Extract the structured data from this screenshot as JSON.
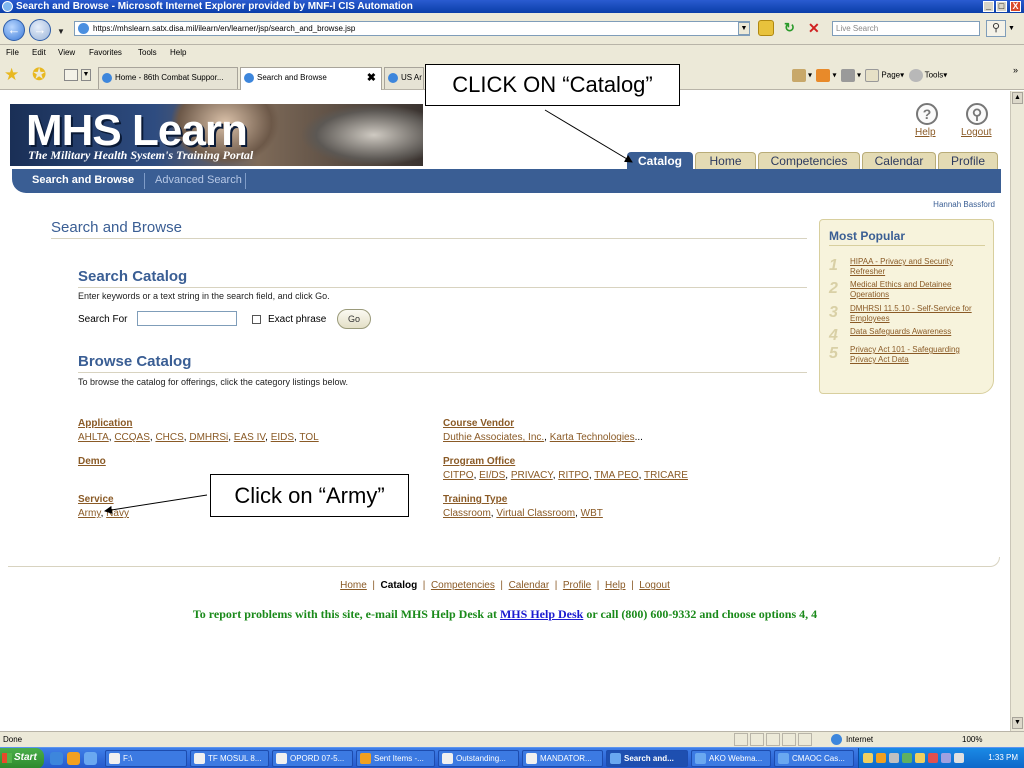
{
  "window": {
    "title": "Search and Browse - Microsoft Internet Explorer provided by MNF-I CIS Automation",
    "minimize": "_",
    "maximize": "□",
    "close": "X"
  },
  "address": {
    "url": "https://mhslearn.satx.disa.mil/ilearn/en/learner/jsp/search_and_browse.jsp",
    "search_placeholder": "Live Search"
  },
  "menu": [
    "File",
    "Edit",
    "View",
    "Favorites",
    "Tools",
    "Help"
  ],
  "tabs": [
    {
      "label": "Home - 86th Combat Suppor..."
    },
    {
      "label": "Search and Browse",
      "close": "✖"
    },
    {
      "label": "US Ar"
    }
  ],
  "command_bar": {
    "page": "Page",
    "tools": "Tools"
  },
  "site": {
    "logo": "MHS Learn",
    "tagline": "The Military Health System's Training Portal",
    "help": "Help",
    "logout": "Logout",
    "nav_tabs": [
      "Catalog",
      "Home",
      "Competencies",
      "Calendar",
      "Profile"
    ],
    "subnav": [
      "Search and Browse",
      "Advanced Search"
    ],
    "user_name": "Hannah Bassford"
  },
  "page": {
    "title": "Search and Browse",
    "search_catalog": {
      "heading": "Search Catalog",
      "instructions": "Enter keywords or a text string in the search field, and click Go.",
      "search_label": "Search For",
      "search_value": "",
      "exact_phrase": "Exact phrase",
      "go": "Go"
    },
    "browse_catalog": {
      "heading": "Browse Catalog",
      "instructions": "To browse the catalog for offerings, click the category listings below."
    },
    "categories": {
      "application": {
        "heading": "Application",
        "items": [
          "AHLTA",
          "CCQAS",
          "CHCS",
          "DMHRSi",
          "EAS IV",
          "EIDS",
          "TOL"
        ]
      },
      "demo": {
        "heading": "Demo"
      },
      "service": {
        "heading": "Service",
        "items": [
          "Army",
          "Navy"
        ]
      },
      "course_vendor": {
        "heading": "Course Vendor",
        "items": [
          "Duthie Associates, Inc.",
          "Karta Technologies"
        ],
        "more": "..."
      },
      "program_office": {
        "heading": "Program Office",
        "items": [
          "CITPO",
          "EI/DS",
          "PRIVACY",
          "RITPO",
          "TMA PEO",
          "TRICARE"
        ]
      },
      "training_type": {
        "heading": "Training Type",
        "items": [
          "Classroom",
          "Virtual Classroom",
          "WBT"
        ]
      }
    }
  },
  "most_popular": {
    "title": "Most Popular",
    "items": [
      {
        "num": "1",
        "line1": "HIPAA - Privacy and Security",
        "line2": "Refresher"
      },
      {
        "num": "2",
        "line1": "Medical Ethics and Detainee",
        "line2": "Operations"
      },
      {
        "num": "3",
        "line1": "DMHRSI 11.5.10 - Self-Service for",
        "line2": "Employees"
      },
      {
        "num": "4",
        "line1": "Data Safeguards Awareness",
        "line2": ""
      },
      {
        "num": "5",
        "line1": "Privacy Act 101 - Safeguarding",
        "line2": "Privacy Act Data"
      }
    ]
  },
  "footer": {
    "links": [
      "Home",
      "Catalog",
      "Competencies",
      "Calendar",
      "Profile",
      "Help",
      "Logout"
    ],
    "support_before": "To report problems with this site, e-mail MHS Help Desk at",
    "support_link": "MHS Help Desk",
    "support_after": "or call (800) 600-9332 and choose options 4, 4"
  },
  "annotations": {
    "catalog_callout": "CLICK ON “Catalog”",
    "army_callout": "Click on “Army”"
  },
  "status": {
    "text": "Done",
    "zone": "Internet",
    "zoom": "100%"
  },
  "taskbar": {
    "start": "Start",
    "buttons": [
      "F:\\",
      "TF MOSUL 8...",
      "OPORD 07-5...",
      "Sent Items -...",
      "Outstanding...",
      "MANDATOR...",
      "Search and...",
      "AKO Webma...",
      "CMAOC Cas..."
    ],
    "clock": "1:33 PM"
  }
}
